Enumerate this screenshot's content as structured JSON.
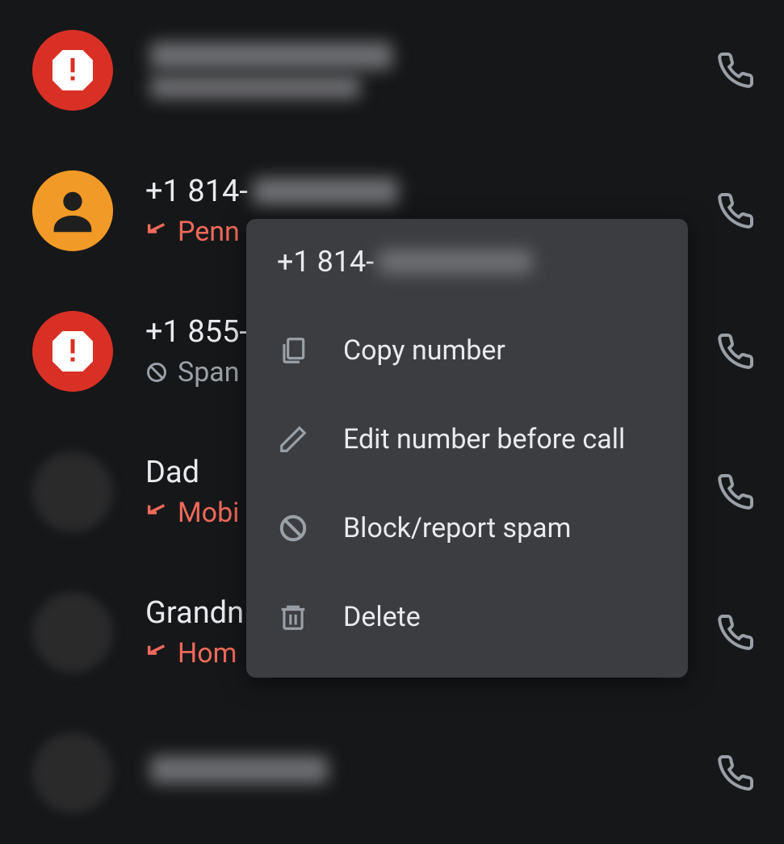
{
  "calls": [
    {
      "avatar": "spam",
      "title_visible": "",
      "title_blurred": true,
      "sub_text": "",
      "sub_type": "missed",
      "sub_icon": ""
    },
    {
      "avatar": "person",
      "title_visible": "+1 814-",
      "title_blurred": true,
      "sub_text": "Penn",
      "sub_type": "missed",
      "sub_icon": "missed"
    },
    {
      "avatar": "spam",
      "title_visible": "+1 855-",
      "title_blurred": true,
      "sub_text": "Span",
      "sub_type": "normal",
      "sub_icon": "block"
    },
    {
      "avatar": "photo",
      "title_visible": "Dad",
      "title_blurred": false,
      "sub_text": "Mobi",
      "sub_type": "missed",
      "sub_icon": "missed"
    },
    {
      "avatar": "photo",
      "title_visible": "Grandn",
      "title_blurred": false,
      "sub_text": "Hom",
      "sub_type": "missed",
      "sub_icon": "missed"
    },
    {
      "avatar": "photo",
      "title_visible": "",
      "title_blurred": true,
      "sub_text": "",
      "sub_type": "normal",
      "sub_icon": ""
    }
  ],
  "popup": {
    "title_visible": "+1 814-",
    "items": [
      {
        "icon": "copy",
        "label": "Copy number"
      },
      {
        "icon": "edit",
        "label": "Edit number before call"
      },
      {
        "icon": "block",
        "label": "Block/report spam"
      },
      {
        "icon": "delete",
        "label": "Delete"
      }
    ]
  }
}
